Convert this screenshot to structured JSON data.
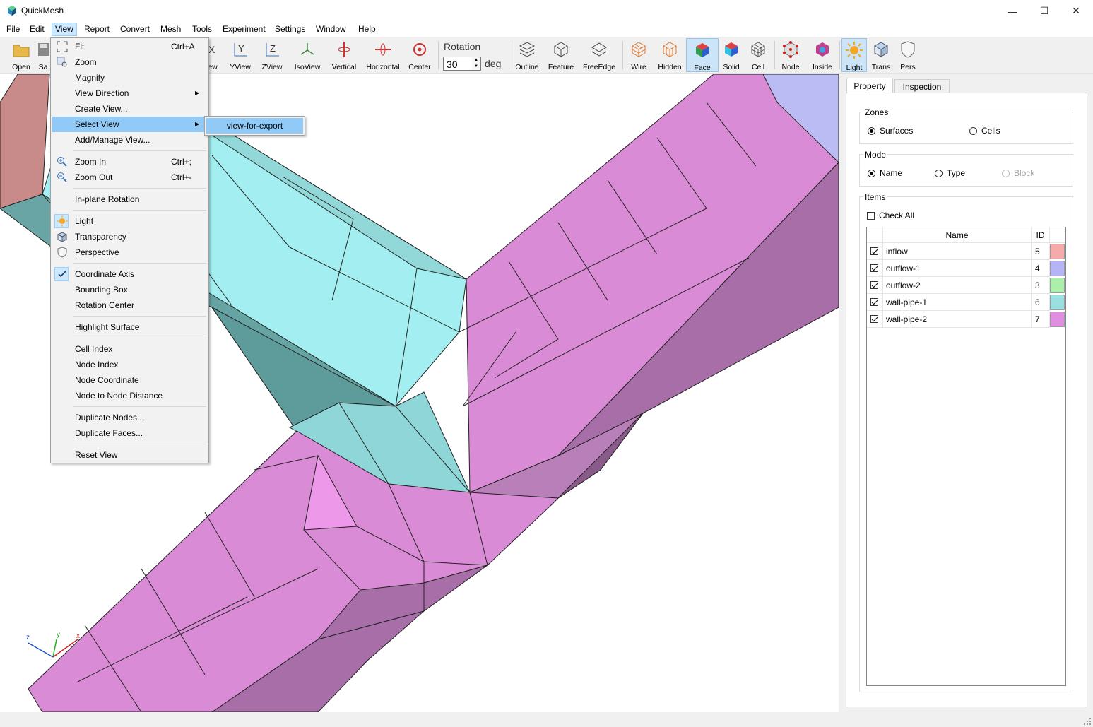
{
  "window": {
    "title": "QuickMesh",
    "minimize": "—",
    "maximize": "☐",
    "close": "✕"
  },
  "menubar": [
    "File",
    "Edit",
    "View",
    "Report",
    "Convert",
    "Mesh",
    "Tools",
    "Experiment",
    "Settings",
    "Window",
    "Help"
  ],
  "toolbar": {
    "open": "Open",
    "save": "Sa",
    "view_partial": "ew",
    "yview": "YView",
    "zview": "ZView",
    "isoview": "IsoView",
    "vertical": "Vertical",
    "horizontal": "Horizontal",
    "center": "Center",
    "rotation_label": "Rotation",
    "rotation_value": "30",
    "rotation_unit": "deg",
    "outline": "Outline",
    "feature": "Feature",
    "freeedge": "FreeEdge",
    "wire": "Wire",
    "hidden": "Hidden",
    "face": "Face",
    "solid": "Solid",
    "cell": "Cell",
    "node": "Node",
    "inside": "Inside",
    "light": "Light",
    "trans": "Trans",
    "pers": "Pers"
  },
  "view_menu": {
    "fit": "Fit",
    "fit_sc": "Ctrl+A",
    "zoom": "Zoom",
    "magnify": "Magnify",
    "view_direction": "View Direction",
    "create_view": "Create View...",
    "select_view": "Select View",
    "add_manage_view": "Add/Manage View...",
    "zoom_in": "Zoom In",
    "zoom_in_sc": "Ctrl+;",
    "zoom_out": "Zoom Out",
    "zoom_out_sc": "Ctrl+-",
    "inplane_rotation": "In-plane Rotation",
    "light": "Light",
    "transparency": "Transparency",
    "perspective": "Perspective",
    "coordinate_axis": "Coordinate Axis",
    "bounding_box": "Bounding Box",
    "rotation_center": "Rotation Center",
    "highlight_surface": "Highlight Surface",
    "cell_index": "Cell Index",
    "node_index": "Node Index",
    "node_coordinate": "Node Coordinate",
    "node_to_node_distance": "Node to Node Distance",
    "duplicate_nodes": "Duplicate Nodes...",
    "duplicate_faces": "Duplicate Faces...",
    "reset_view": "Reset View",
    "submenu_item": "view-for-export"
  },
  "panel": {
    "tab_property": "Property",
    "tab_inspection": "Inspection",
    "zones_title": "Zones",
    "zones_surfaces": "Surfaces",
    "zones_cells": "Cells",
    "mode_title": "Mode",
    "mode_name": "Name",
    "mode_type": "Type",
    "mode_block": "Block",
    "items_title": "Items",
    "check_all": "Check All",
    "col_name": "Name",
    "col_id": "ID",
    "rows": [
      {
        "name": "inflow",
        "id": "5",
        "color": "#f7aaaa"
      },
      {
        "name": "outflow-1",
        "id": "4",
        "color": "#b4b4f7"
      },
      {
        "name": "outflow-2",
        "id": "3",
        "color": "#aaf0aa"
      },
      {
        "name": "wall-pipe-1",
        "id": "6",
        "color": "#9ae0e0"
      },
      {
        "name": "wall-pipe-2",
        "id": "7",
        "color": "#e08ee0"
      }
    ]
  },
  "axis_triad": {
    "x": "x",
    "y": "y",
    "z": "z"
  },
  "colors": {
    "menu_highlight": "#91c9f7",
    "pressed_button": "#cce4f7",
    "mesh_pink": "#d98bd6",
    "mesh_cyan": "#a6f3f5"
  }
}
